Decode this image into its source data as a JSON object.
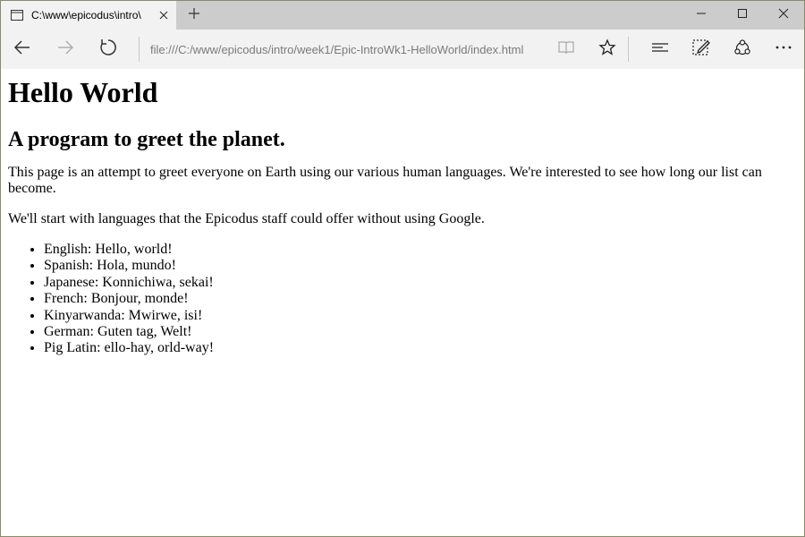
{
  "browser": {
    "tab": {
      "title": "C:\\www\\epicodus\\intro\\"
    },
    "icons": {
      "tab_icon": "page-icon",
      "tab_close": "close-icon",
      "new_tab": "plus-icon",
      "minimize": "minimize-icon",
      "maximize": "maximize-icon",
      "close_window": "close-window-icon",
      "back": "back-arrow-icon",
      "forward": "forward-arrow-icon",
      "refresh": "refresh-icon",
      "reading_view": "book-icon",
      "favorite": "star-icon",
      "hub": "hub-icon",
      "web_note": "pen-note-icon",
      "share": "share-icon",
      "more": "more-icon"
    },
    "address": "file:///C:/www/epicodus/intro/week1/Epic-IntroWk1-HelloWorld/index.html"
  },
  "page": {
    "heading": "Hello World",
    "subheading": "A program to greet the planet.",
    "intro": "This page is an attempt to greet everyone on Earth using our various human languages. We're interested to see how long our list can become.",
    "note": "We'll start with languages that the Epicodus staff could offer without using Google.",
    "languages": [
      "English: Hello, world!",
      "Spanish: Hola, mundo!",
      "Japanese: Konnichiwa, sekai!",
      "French: Bonjour, monde!",
      "Kinyarwanda: Mwirwe, isi!",
      "German: Guten tag, Welt!",
      "Pig Latin: ello-hay, orld-way!"
    ]
  }
}
